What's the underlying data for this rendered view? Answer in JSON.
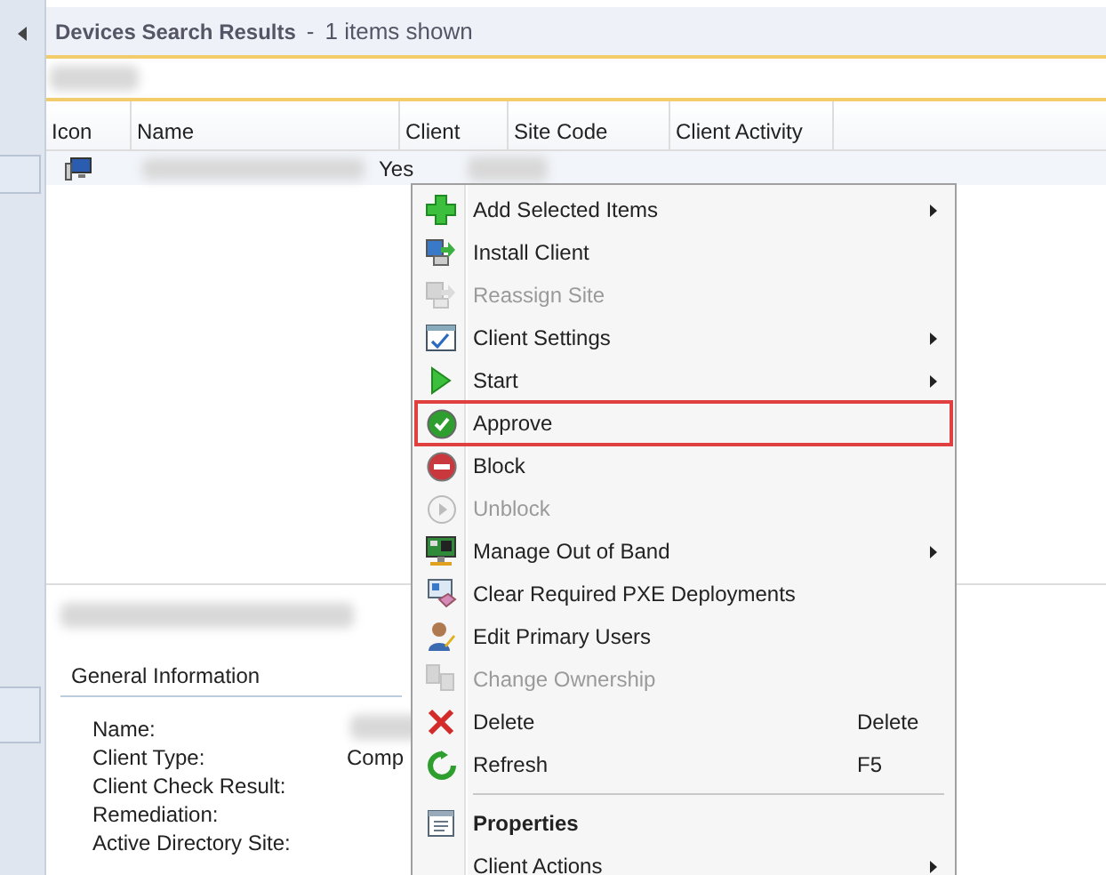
{
  "header": {
    "title": "Devices Search Results",
    "separator": "-",
    "count": "1 items shown"
  },
  "table": {
    "columns": [
      "Icon",
      "Name",
      "Client",
      "Site Code",
      "Client Activity"
    ],
    "rows": [
      {
        "client": "Yes",
        "selected": true
      }
    ]
  },
  "details": {
    "section": "General Information",
    "fields": [
      {
        "label": "Name:",
        "redacted": true
      },
      {
        "label": "Client Type:",
        "value": "Comp",
        "redacted": false
      },
      {
        "label": "Client Check Result:",
        "redacted": false
      },
      {
        "label": "Remediation:",
        "redacted": false
      },
      {
        "label": "Active Directory Site:",
        "redacted": false
      }
    ]
  },
  "context_menu": {
    "items": [
      {
        "kind": "item",
        "label": "Add Selected Items",
        "disabled": false,
        "submenu": true,
        "bold": false,
        "highlighted": false
      },
      {
        "kind": "item",
        "label": "Install Client",
        "disabled": false,
        "submenu": false,
        "bold": false,
        "highlighted": false
      },
      {
        "kind": "item",
        "label": "Reassign Site",
        "disabled": true,
        "submenu": false,
        "bold": false,
        "highlighted": false
      },
      {
        "kind": "item",
        "label": "Client Settings",
        "disabled": false,
        "submenu": true,
        "bold": false,
        "highlighted": false
      },
      {
        "kind": "item",
        "label": "Start",
        "disabled": false,
        "submenu": true,
        "bold": false,
        "highlighted": false
      },
      {
        "kind": "item",
        "label": "Approve",
        "disabled": false,
        "submenu": false,
        "bold": false,
        "highlighted": true
      },
      {
        "kind": "item",
        "label": "Block",
        "disabled": false,
        "submenu": false,
        "bold": false,
        "highlighted": false
      },
      {
        "kind": "item",
        "label": "Unblock",
        "disabled": true,
        "submenu": false,
        "bold": false,
        "highlighted": false
      },
      {
        "kind": "item",
        "label": "Manage Out of Band",
        "disabled": false,
        "submenu": true,
        "bold": false,
        "highlighted": false
      },
      {
        "kind": "item",
        "label": "Clear Required PXE Deployments",
        "disabled": false,
        "submenu": false,
        "bold": false,
        "highlighted": false
      },
      {
        "kind": "item",
        "label": "Edit Primary Users",
        "disabled": false,
        "submenu": false,
        "bold": false,
        "highlighted": false
      },
      {
        "kind": "item",
        "label": "Change Ownership",
        "disabled": true,
        "submenu": false,
        "bold": false,
        "highlighted": false
      },
      {
        "kind": "item",
        "label": "Delete",
        "shortcut": "Delete",
        "disabled": false,
        "submenu": false,
        "bold": false,
        "highlighted": false
      },
      {
        "kind": "item",
        "label": "Refresh",
        "shortcut": "F5",
        "disabled": false,
        "submenu": false,
        "bold": false,
        "highlighted": false
      },
      {
        "kind": "separator"
      },
      {
        "kind": "item",
        "label": "Properties",
        "disabled": false,
        "submenu": false,
        "bold": true,
        "highlighted": false
      },
      {
        "kind": "item",
        "label": "Client Actions",
        "disabled": false,
        "submenu": true,
        "bold": false,
        "highlighted": false
      }
    ]
  }
}
